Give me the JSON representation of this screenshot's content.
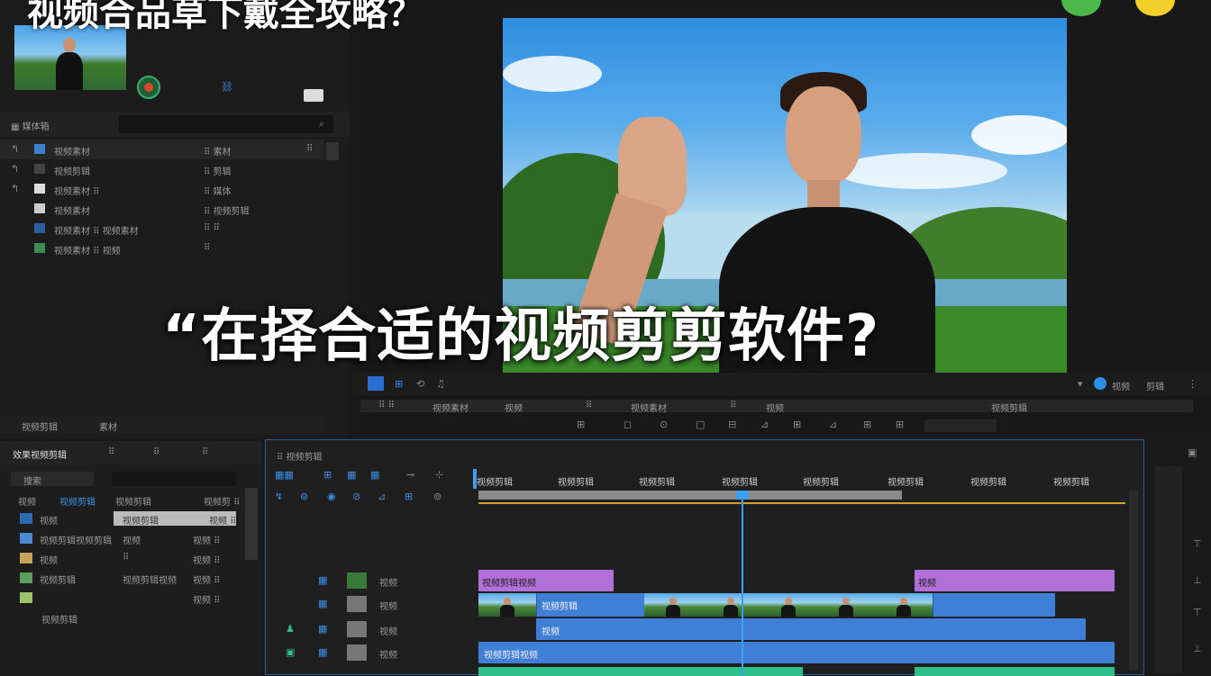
{
  "overlay": {
    "top_title": "视频合品草下戴全攻略？",
    "big_caption": "“在择合适的视频剪剪软件?"
  },
  "media_panel": {
    "header_label": "▦ 媒体箱",
    "rows": [
      {
        "name": "视频素材",
        "value": "⠿ 素材",
        "tail": "⠿"
      },
      {
        "name": "视频剪辑",
        "value": "⠿ 剪辑",
        "tail": ""
      },
      {
        "name": "视频素材 ⠿",
        "value": "⠿ 媒体",
        "tail": ""
      },
      {
        "name": "视频素材",
        "value": "⠿ 视频剪辑",
        "tail": "⠿"
      },
      {
        "name": "视频素材 ⠿ 视频素材",
        "value": "⠿ ⠿",
        "tail": ""
      },
      {
        "name": "视频素材 ⠿ 视频",
        "value": "⠿",
        "tail": ""
      }
    ],
    "footer_left": "视频剪辑",
    "footer_mid": "素材"
  },
  "preview": {
    "toolbar_right_label": "视频",
    "toolbar_right_label2": "剪辑",
    "timeline_labels": [
      "⠿ ⠿",
      "视频素材",
      "视频",
      "⠿",
      "视频素材",
      "⠿",
      "视频",
      "视频剪辑"
    ],
    "controls": [
      "⊞",
      "◻",
      "⊙",
      "▢",
      "⊟",
      "⊿",
      "⊞",
      "⊿",
      "⊞",
      "⊞"
    ]
  },
  "effects_panel": {
    "tabs": [
      "效果视频剪辑",
      "⠿",
      "⠿",
      "⠿"
    ],
    "search_label": "搜索",
    "head_cols": [
      "视频",
      "视频剪辑",
      "视频剪辑",
      "视频剪 ⠿"
    ],
    "rows": [
      {
        "name": "视频",
        "mid": "视频剪辑",
        "right": "视频 ⠿"
      },
      {
        "name": "视频剪辑视频剪辑",
        "mid": "视频",
        "right": "视频 ⠿"
      },
      {
        "name": "视频",
        "mid": "⠿",
        "right": "视频 ⠿"
      },
      {
        "name": "视频剪辑",
        "mid": "视频剪辑视频",
        "right": "视频 ⠿"
      },
      {
        "name": "",
        "mid": "",
        "right": "视频 ⠿"
      }
    ],
    "footer": "视频剪辑"
  },
  "timeline": {
    "title": "⠿ 视频剪辑",
    "ruler": [
      "视频剪辑",
      "视频剪辑",
      "视频剪辑",
      "视频剪辑",
      "视频剪辑",
      "视频剪辑",
      "视频剪辑",
      "视频剪辑"
    ],
    "tracks": [
      {
        "label": "视频",
        "clips": [
          "视频剪辑视频",
          "视频"
        ]
      },
      {
        "label": "视频",
        "clips": [
          "视频剪辑"
        ]
      },
      {
        "label": "视频",
        "clips": [
          "视频"
        ]
      },
      {
        "label": "视频",
        "clips": [
          "视频剪辑视频"
        ]
      }
    ]
  },
  "colors": {
    "accent": "#2f8ee8",
    "clip_purple": "#b26fd8",
    "clip_blue": "#3f7fd6",
    "clip_green": "#2fbf8a",
    "playhead": "#3aa0ff"
  }
}
